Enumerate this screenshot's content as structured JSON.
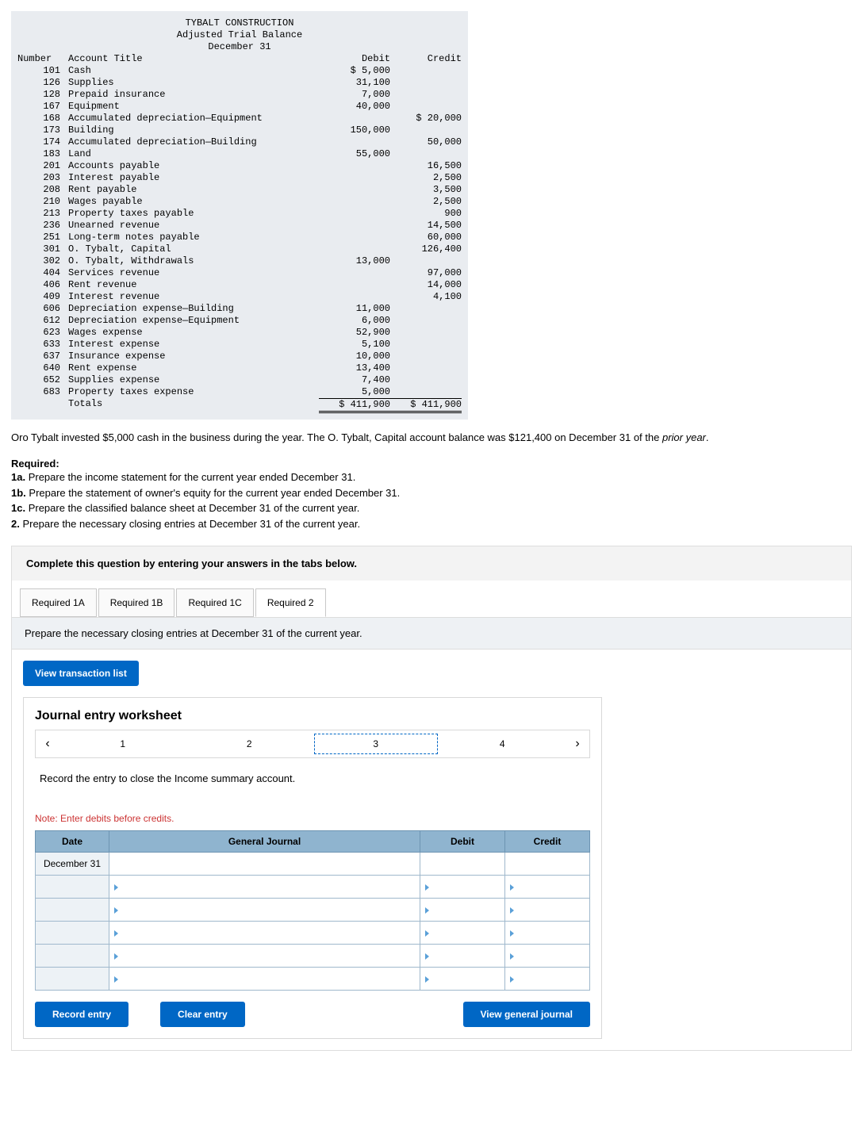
{
  "trial_balance": {
    "company": "TYBALT CONSTRUCTION",
    "title": "Adjusted Trial Balance",
    "date": "December 31",
    "cols": {
      "num": "Number",
      "acct": "Account Title",
      "debit": "Debit",
      "credit": "Credit"
    },
    "rows": [
      {
        "n": "101",
        "t": "Cash",
        "d": "$ 5,000",
        "c": ""
      },
      {
        "n": "126",
        "t": "Supplies",
        "d": "31,100",
        "c": ""
      },
      {
        "n": "128",
        "t": "Prepaid insurance",
        "d": "7,000",
        "c": ""
      },
      {
        "n": "167",
        "t": "Equipment",
        "d": "40,000",
        "c": ""
      },
      {
        "n": "168",
        "t": "Accumulated depreciation—Equipment",
        "d": "",
        "c": "$ 20,000"
      },
      {
        "n": "173",
        "t": "Building",
        "d": "150,000",
        "c": ""
      },
      {
        "n": "174",
        "t": "Accumulated depreciation—Building",
        "d": "",
        "c": "50,000"
      },
      {
        "n": "183",
        "t": "Land",
        "d": "55,000",
        "c": ""
      },
      {
        "n": "201",
        "t": "Accounts payable",
        "d": "",
        "c": "16,500"
      },
      {
        "n": "203",
        "t": "Interest payable",
        "d": "",
        "c": "2,500"
      },
      {
        "n": "208",
        "t": "Rent payable",
        "d": "",
        "c": "3,500"
      },
      {
        "n": "210",
        "t": "Wages payable",
        "d": "",
        "c": "2,500"
      },
      {
        "n": "213",
        "t": "Property taxes payable",
        "d": "",
        "c": "900"
      },
      {
        "n": "236",
        "t": "Unearned revenue",
        "d": "",
        "c": "14,500"
      },
      {
        "n": "251",
        "t": "Long-term notes payable",
        "d": "",
        "c": "60,000"
      },
      {
        "n": "301",
        "t": "O. Tybalt, Capital",
        "d": "",
        "c": "126,400"
      },
      {
        "n": "302",
        "t": "O. Tybalt, Withdrawals",
        "d": "13,000",
        "c": ""
      },
      {
        "n": "404",
        "t": "Services revenue",
        "d": "",
        "c": "97,000"
      },
      {
        "n": "406",
        "t": "Rent revenue",
        "d": "",
        "c": "14,000"
      },
      {
        "n": "409",
        "t": "Interest revenue",
        "d": "",
        "c": "4,100"
      },
      {
        "n": "606",
        "t": "Depreciation expense—Building",
        "d": "11,000",
        "c": ""
      },
      {
        "n": "612",
        "t": "Depreciation expense—Equipment",
        "d": "6,000",
        "c": ""
      },
      {
        "n": "623",
        "t": "Wages expense",
        "d": "52,900",
        "c": ""
      },
      {
        "n": "633",
        "t": "Interest expense",
        "d": "5,100",
        "c": ""
      },
      {
        "n": "637",
        "t": "Insurance expense",
        "d": "10,000",
        "c": ""
      },
      {
        "n": "640",
        "t": "Rent expense",
        "d": "13,400",
        "c": ""
      },
      {
        "n": "652",
        "t": "Supplies expense",
        "d": "7,400",
        "c": ""
      },
      {
        "n": "683",
        "t": "Property taxes expense",
        "d": "5,000",
        "c": ""
      }
    ],
    "totals": {
      "label": "Totals",
      "d": "$ 411,900",
      "c": "$ 411,900"
    }
  },
  "narrative": "Oro Tybalt invested $5,000 cash in the business during the year. The O. Tybalt, Capital account balance was $121,400 on December 31 of the ",
  "narrative_em": "prior year",
  "narrative_end": ".",
  "required": {
    "head": "Required:",
    "items": [
      {
        "b": "1a.",
        "t": " Prepare the income statement for the current year ended December 31."
      },
      {
        "b": "1b.",
        "t": " Prepare the statement of owner's equity for the current year ended December 31."
      },
      {
        "b": "1c.",
        "t": " Prepare the classified balance sheet at December 31 of the current year."
      },
      {
        "b": "2.",
        "t": " Prepare the necessary closing entries at December 31 of the current year."
      }
    ]
  },
  "panel": {
    "instr": "Complete this question by entering your answers in the tabs below.",
    "tabs": [
      "Required 1A",
      "Required 1B",
      "Required 1C",
      "Required 2"
    ],
    "sub_instr": "Prepare the necessary closing entries at December 31 of the current year.",
    "view_trans": "View transaction list"
  },
  "worksheet": {
    "title": "Journal entry worksheet",
    "steps": [
      "1",
      "2",
      "3",
      "4"
    ],
    "current": "3",
    "desc": "Record the entry to close the Income summary account.",
    "note": "Note: Enter debits before credits.",
    "th": {
      "date": "Date",
      "gj": "General Journal",
      "deb": "Debit",
      "cred": "Credit"
    },
    "date": "December 31",
    "btn_record": "Record entry",
    "btn_clear": "Clear entry",
    "btn_view": "View general journal"
  }
}
